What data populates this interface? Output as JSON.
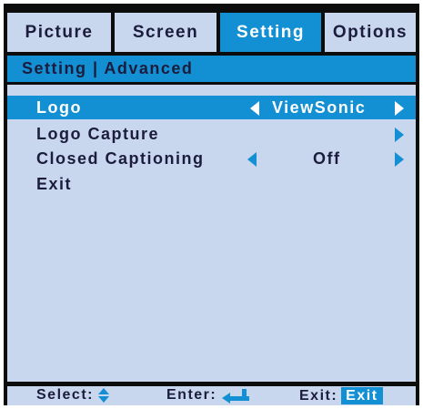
{
  "tabs": [
    {
      "label": "Picture",
      "active": false
    },
    {
      "label": "Screen",
      "active": false
    },
    {
      "label": "Setting",
      "active": true
    },
    {
      "label": "Options",
      "active": false
    }
  ],
  "header": {
    "title": "Setting | Advanced"
  },
  "menu": {
    "items": [
      {
        "label": "Logo",
        "value": "ViewSonic",
        "selected": true
      },
      {
        "label": "Logo Capture",
        "value": ""
      },
      {
        "label": "Closed Captioning",
        "value": "Off"
      },
      {
        "label": "Exit",
        "value": ""
      }
    ]
  },
  "footer": {
    "select_label": "Select:",
    "enter_label": "Enter:",
    "exit_label": "Exit:",
    "exit_key": "Exit"
  },
  "colors": {
    "accent": "#138fd3",
    "panel": "#c8d6ee",
    "frame": "#0c0c0c",
    "text": "#1c1c3c"
  },
  "icons": [
    "left-arrow-icon",
    "right-arrow-icon",
    "up-down-arrows-icon",
    "enter-icon"
  ]
}
